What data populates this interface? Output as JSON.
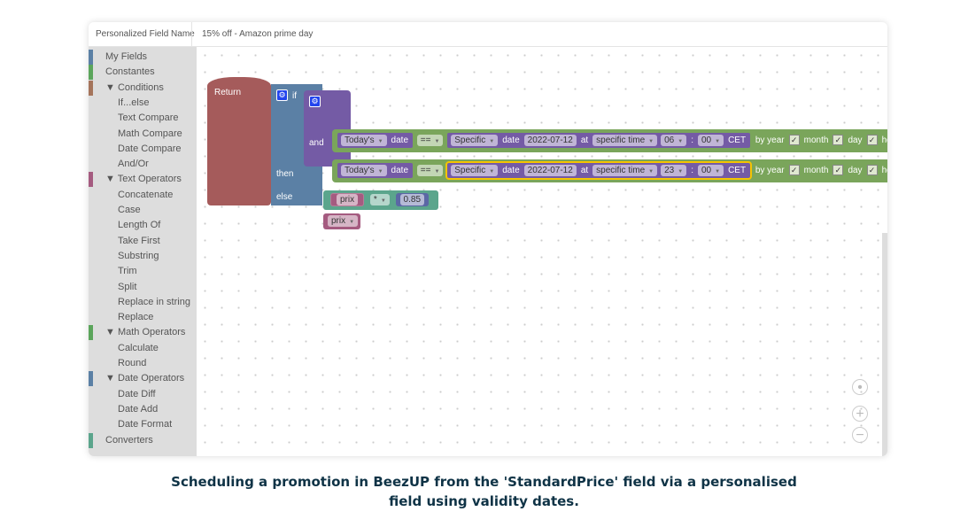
{
  "header": {
    "field_label": "Personalized Field Name",
    "field_value": "15% off - Amazon prime day"
  },
  "sidebar": {
    "items": [
      {
        "label": "My Fields",
        "level": 0,
        "color": "#5b80a5"
      },
      {
        "label": "Constantes",
        "level": 0,
        "color": "#5ba55b"
      },
      {
        "label": "▼ Conditions",
        "level": 0,
        "color": "#a5745b"
      },
      {
        "label": "If...else",
        "level": 1
      },
      {
        "label": "Text Compare",
        "level": 1
      },
      {
        "label": "Math Compare",
        "level": 1
      },
      {
        "label": "Date Compare",
        "level": 1
      },
      {
        "label": "And/Or",
        "level": 1
      },
      {
        "label": "▼ Text Operators",
        "level": 0,
        "color": "#a55b80"
      },
      {
        "label": "Concatenate",
        "level": 1
      },
      {
        "label": "Case",
        "level": 1
      },
      {
        "label": "Length Of",
        "level": 1
      },
      {
        "label": "Take First",
        "level": 1
      },
      {
        "label": "Substring",
        "level": 1
      },
      {
        "label": "Trim",
        "level": 1
      },
      {
        "label": "Split",
        "level": 1
      },
      {
        "label": "Replace in string",
        "level": 1
      },
      {
        "label": "Replace",
        "level": 1
      },
      {
        "label": "▼ Math Operators",
        "level": 0,
        "color": "#5ba55b"
      },
      {
        "label": "Calculate",
        "level": 1
      },
      {
        "label": "Round",
        "level": 1
      },
      {
        "label": "▼ Date Operators",
        "level": 0,
        "color": "#5b80a5"
      },
      {
        "label": "Date Diff",
        "level": 1
      },
      {
        "label": "Date Add",
        "level": 1
      },
      {
        "label": "Date Format",
        "level": 1
      },
      {
        "label": "Converters",
        "level": 0,
        "color": "#5ba58c"
      }
    ]
  },
  "blocks": {
    "return": "Return",
    "if": "if",
    "and": "and",
    "then": "then",
    "else": "else",
    "rows": [
      {
        "left": "Today's",
        "date": "date",
        "op": "==",
        "right": "Specific",
        "date2": "date",
        "date_value": "2022-07-12",
        "at": "at",
        "time_mode": "specific time",
        "hour": "06",
        "colon": ":",
        "minute": "00",
        "tz": "CET",
        "by": "by year",
        "month": "month",
        "day": "day",
        "hour_label": "hour"
      },
      {
        "left": "Today's",
        "date": "date",
        "op": "==",
        "right": "Specific",
        "date2": "date",
        "date_value": "2022-07-12",
        "at": "at",
        "time_mode": "specific time",
        "hour": "23",
        "colon": ":",
        "minute": "00",
        "tz": "CET",
        "by": "by year",
        "month": "month",
        "day": "day",
        "hour_label": "hour"
      }
    ],
    "then_field": "prix",
    "then_op": "*",
    "then_value": "0.85",
    "else_field": "prix"
  },
  "caption": {
    "line1": "Scheduling a promotion in BeezUP from the 'StandardPrice' field via a personalised",
    "line2": "field using validity dates."
  }
}
